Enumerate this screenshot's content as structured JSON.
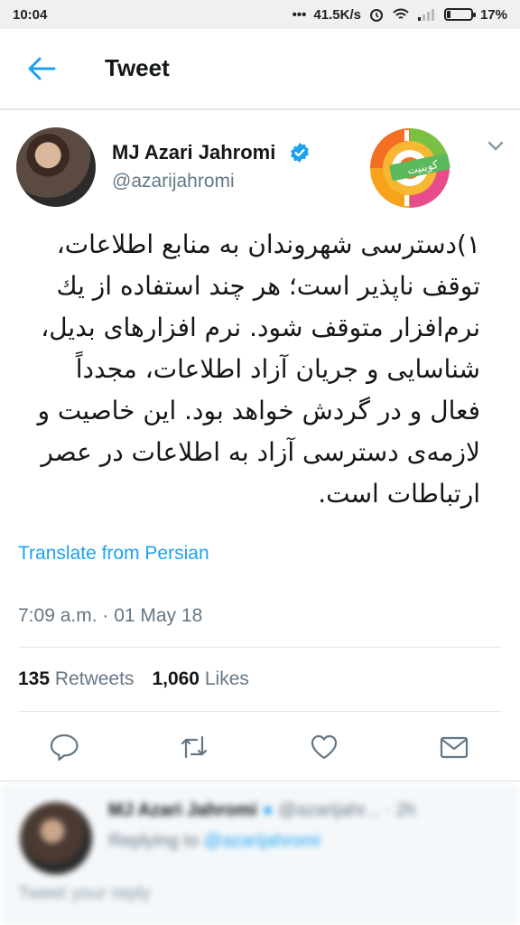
{
  "status_bar": {
    "time": "10:04",
    "network_speed": "41.5K/s",
    "battery": "17%",
    "battery_level": 0.17
  },
  "header": {
    "title": "Tweet"
  },
  "tweet": {
    "author_name": "MJ Azari Jahromi",
    "handle": "@azarijahromi",
    "logo_text": "کوینیت",
    "text": "۱)دسترسی شهروندان به منابع اطلاعات، توقف ناپذیر است؛ هر چند استفاده از یك نرم‌افزار متوقف شود. نرم افزارهای بدیل، شناسایی و جریان آزاد اطلاعات، مجدداً فعال و در گردش خواهد بود. این خاصیت و لازمه‌ی دسترسی آزاد به اطلاعات در عصر ارتباطات است.",
    "translate_link": "Translate from Persian",
    "timestamp": "7:09 a.m. · 01 May 18",
    "retweets_count": "135",
    "retweets_label": "Retweets",
    "likes_count": "1,060",
    "likes_label": "Likes"
  },
  "reply_section": {
    "author_name": "MJ Azari Jahromi",
    "handle": "@azarijahr...",
    "time": "· 2h",
    "replying_to_label": "Replying to",
    "replying_to_handle": "@azarijahromi",
    "input_placeholder": "Tweet your reply"
  },
  "colors": {
    "accent": "#1da1f2",
    "secondary_text": "#657786",
    "primary_text": "#14171a"
  },
  "icons": [
    "back-arrow-icon",
    "verified-badge-icon",
    "chevron-down-icon",
    "reply-icon",
    "retweet-icon",
    "like-icon",
    "share-icon"
  ]
}
